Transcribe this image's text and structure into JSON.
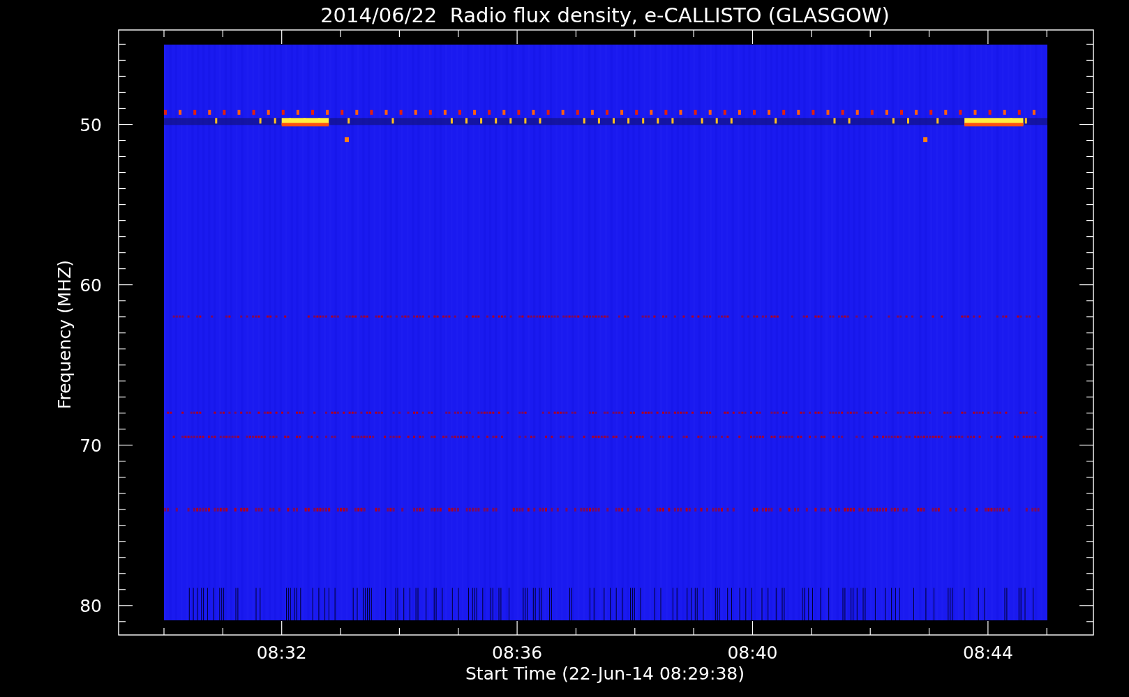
{
  "title": "2014/06/22  Radio flux density, e-CALLISTO (GLASGOW)",
  "plot": {
    "ylabel": "Frequency (MHZ)",
    "xlabel": "Start Time (22-Jun-14 08:29:38)",
    "yticks": [
      "50",
      "60",
      "70",
      "80"
    ],
    "xticks": [
      "08:32",
      "08:36",
      "08:40",
      "08:44"
    ]
  }
}
